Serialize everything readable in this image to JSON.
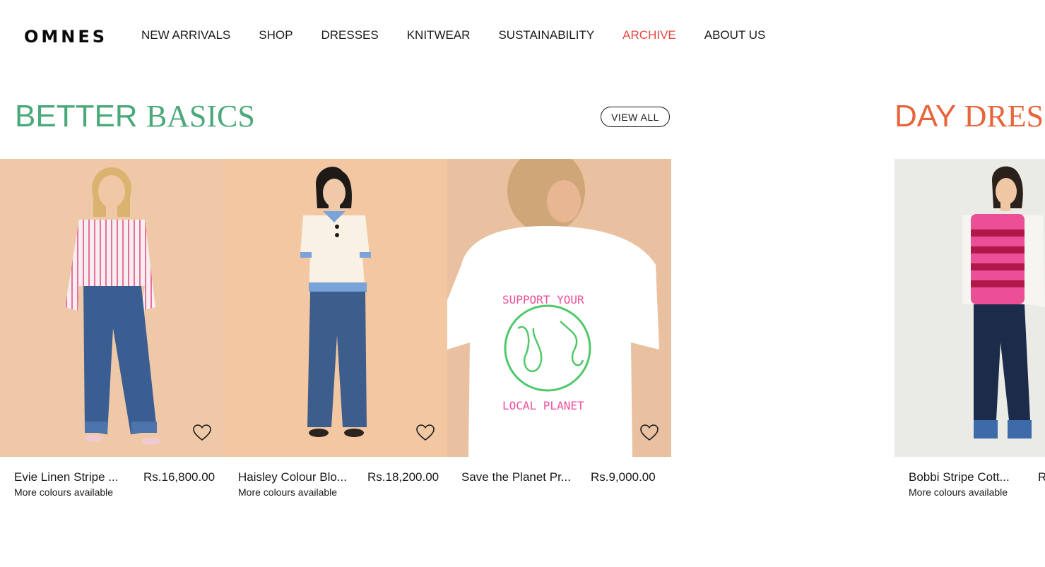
{
  "brand": {
    "logo": "OMNES"
  },
  "nav": {
    "items": [
      "NEW ARRIVALS",
      "SHOP",
      "DRESSES",
      "KNITWEAR",
      "SUSTAINABILITY",
      "ARCHIVE",
      "ABOUT US"
    ],
    "active_color": "#e8463f"
  },
  "sections": [
    {
      "title_word1": "BETTER",
      "title_word2": "BASICS",
      "title_color": "#4aa97a",
      "view_all": "VIEW ALL",
      "products": [
        {
          "name": "Evie Linen Stripe ...",
          "price": "Rs.16,800.00",
          "note": "More colours available",
          "icon": "heart-icon"
        },
        {
          "name": "Haisley Colour Blo...",
          "price": "Rs.18,200.00",
          "note": "More colours available",
          "icon": "heart-icon"
        },
        {
          "name": "Save the Planet Pr...",
          "price": "Rs.9,000.00",
          "note": "",
          "icon": "heart-icon"
        }
      ]
    },
    {
      "title_word1": "DAY",
      "title_word2": "DRES",
      "title_color": "#e8643a",
      "products": [
        {
          "name": "Bobbi Stripe Cott...",
          "price": "R",
          "note": "More colours available"
        }
      ]
    }
  ],
  "tshirt_print": {
    "top": "SUPPORT YOUR",
    "bottom": "LOCAL PLANET"
  }
}
